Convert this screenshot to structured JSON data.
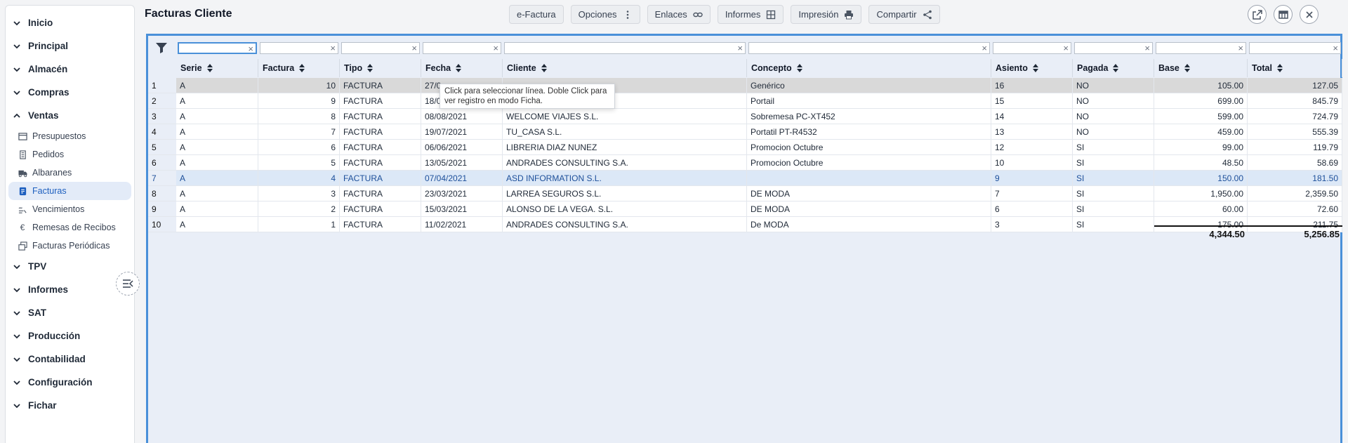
{
  "app": {
    "title": "Facturas Cliente"
  },
  "sidebar": {
    "sections": [
      {
        "label": "Inicio",
        "expanded": false
      },
      {
        "label": "Principal",
        "expanded": false
      },
      {
        "label": "Almacén",
        "expanded": false
      },
      {
        "label": "Compras",
        "expanded": false
      },
      {
        "label": "Ventas",
        "expanded": true,
        "items": [
          {
            "label": "Presupuestos",
            "icon": "window-icon"
          },
          {
            "label": "Pedidos",
            "icon": "document-lines-icon"
          },
          {
            "label": "Albaranes",
            "icon": "truck-icon"
          },
          {
            "label": "Facturas",
            "icon": "invoice-icon",
            "active": true
          },
          {
            "label": "Vencimientos",
            "icon": "lines-tilde-icon"
          },
          {
            "label": "Remesas de Recibos",
            "icon": "euro-icon"
          },
          {
            "label": "Facturas Periódicas",
            "icon": "stacked-docs-icon"
          }
        ]
      },
      {
        "label": "TPV",
        "expanded": false
      },
      {
        "label": "Informes",
        "expanded": false
      },
      {
        "label": "SAT",
        "expanded": false
      },
      {
        "label": "Producción",
        "expanded": false
      },
      {
        "label": "Contabilidad",
        "expanded": false
      },
      {
        "label": "Configuración",
        "expanded": false
      },
      {
        "label": "Fichar",
        "expanded": false
      }
    ]
  },
  "toolbar": {
    "buttons": [
      {
        "label": "e-Factura",
        "icon": ""
      },
      {
        "label": "Opciones",
        "icon": "kebab-icon"
      },
      {
        "label": "Enlaces",
        "icon": "link-icon"
      },
      {
        "label": "Informes",
        "icon": "grid-icon"
      },
      {
        "label": "Impresión",
        "icon": "printer-icon"
      },
      {
        "label": "Compartir",
        "icon": "share-icon"
      }
    ]
  },
  "window_buttons": [
    "open-external-icon",
    "table-layout-icon",
    "close-icon"
  ],
  "table": {
    "columns": [
      "Serie",
      "Factura",
      "Tipo",
      "Fecha",
      "Cliente",
      "Concepto",
      "Asiento",
      "Pagada",
      "Base",
      "Total"
    ],
    "rows": [
      {
        "n": "1",
        "serie": "A",
        "factura": "10",
        "tipo": "FACTURA",
        "fecha": "27/0",
        "cliente": "",
        "concepto": "Genérico",
        "asiento": "16",
        "pagada": "NO",
        "base": "105.00",
        "total": "127.05"
      },
      {
        "n": "2",
        "serie": "A",
        "factura": "9",
        "tipo": "FACTURA",
        "fecha": "18/0",
        "cliente": "",
        "concepto": "Portail",
        "asiento": "15",
        "pagada": "NO",
        "base": "699.00",
        "total": "845.79"
      },
      {
        "n": "3",
        "serie": "A",
        "factura": "8",
        "tipo": "FACTURA",
        "fecha": "08/08/2021",
        "cliente": "WELCOME VIAJES S.L.",
        "concepto": "Sobremesa PC-XT452",
        "asiento": "14",
        "pagada": "NO",
        "base": "599.00",
        "total": "724.79"
      },
      {
        "n": "4",
        "serie": "A",
        "factura": "7",
        "tipo": "FACTURA",
        "fecha": "19/07/2021",
        "cliente": "TU_CASA S.L.",
        "concepto": "Portatil PT-R4532",
        "asiento": "13",
        "pagada": "NO",
        "base": "459.00",
        "total": "555.39"
      },
      {
        "n": "5",
        "serie": "A",
        "factura": "6",
        "tipo": "FACTURA",
        "fecha": "06/06/2021",
        "cliente": "LIBRERIA DIAZ NUNEZ",
        "concepto": "Promocion Octubre",
        "asiento": "12",
        "pagada": "SI",
        "base": "99.00",
        "total": "119.79"
      },
      {
        "n": "6",
        "serie": "A",
        "factura": "5",
        "tipo": "FACTURA",
        "fecha": "13/05/2021",
        "cliente": "ANDRADES CONSULTING S.A.",
        "concepto": "Promocion Octubre",
        "asiento": "10",
        "pagada": "SI",
        "base": "48.50",
        "total": "58.69"
      },
      {
        "n": "7",
        "serie": "A",
        "factura": "4",
        "tipo": "FACTURA",
        "fecha": "07/04/2021",
        "cliente": "ASD INFORMATION S.L.",
        "concepto": "",
        "asiento": "9",
        "pagada": "SI",
        "base": "150.00",
        "total": "181.50"
      },
      {
        "n": "8",
        "serie": "A",
        "factura": "3",
        "tipo": "FACTURA",
        "fecha": "23/03/2021",
        "cliente": "LARREA SEGUROS S.L.",
        "concepto": "DE MODA",
        "asiento": "7",
        "pagada": "SI",
        "base": "1,950.00",
        "total": "2,359.50"
      },
      {
        "n": "9",
        "serie": "A",
        "factura": "2",
        "tipo": "FACTURA",
        "fecha": "15/03/2021",
        "cliente": "ALONSO DE LA VEGA. S.L.",
        "concepto": "DE MODA",
        "asiento": "6",
        "pagada": "SI",
        "base": "60.00",
        "total": "72.60"
      },
      {
        "n": "10",
        "serie": "A",
        "factura": "1",
        "tipo": "FACTURA",
        "fecha": "11/02/2021",
        "cliente": "ANDRADES CONSULTING S.A.",
        "concepto": "De MODA",
        "asiento": "3",
        "pagada": "SI",
        "base": "175.00",
        "total": "211.75"
      }
    ],
    "selected_row": 0,
    "highlighted_row": 6,
    "totals": {
      "base": "4,344.50",
      "total": "5,256.85"
    }
  },
  "tooltip": {
    "text": "Click para seleccionar línea. Doble Click para ver registro en modo Ficha."
  },
  "colors": {
    "accent": "#4a90d9",
    "active_bg": "#e3ebf8",
    "active_text": "#1d5fbf",
    "grid_bg": "#e9eef7",
    "selected_row": "#d9d9d9",
    "highlight_row": "#dce8f7"
  }
}
